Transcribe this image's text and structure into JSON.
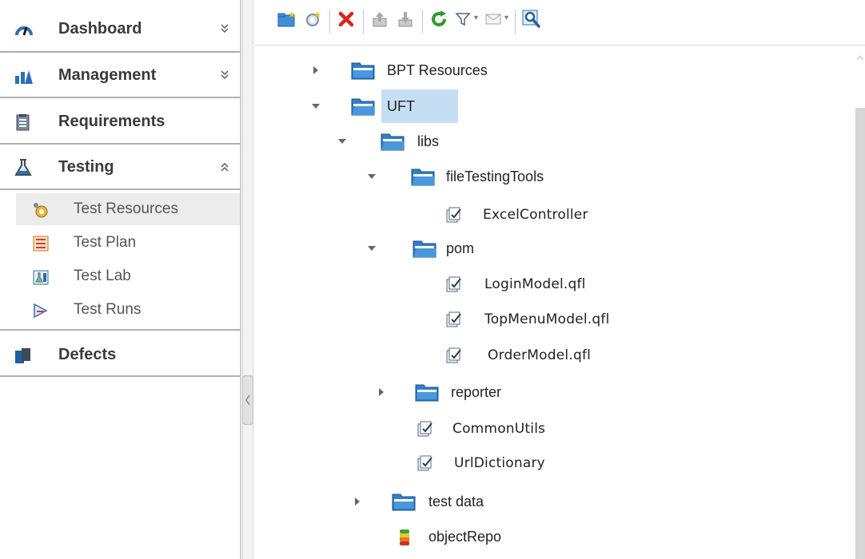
{
  "sidebar": {
    "modules": [
      {
        "label": "Dashboard",
        "icon": "dashboard-gauge-icon",
        "expanded": false
      },
      {
        "label": "Management",
        "icon": "management-chart-icon",
        "expanded": false
      },
      {
        "label": "Requirements",
        "icon": "requirements-clipboard-icon"
      },
      {
        "label": "Testing",
        "icon": "testing-flask-icon",
        "expanded": true
      },
      {
        "label": "Defects",
        "icon": "defects-document-icon"
      }
    ],
    "testing_items": [
      {
        "label": "Test Resources",
        "icon": "test-resources-gear-icon",
        "selected": true
      },
      {
        "label": "Test Plan",
        "icon": "test-plan-icon"
      },
      {
        "label": "Test Lab",
        "icon": "test-lab-icon"
      },
      {
        "label": "Test Runs",
        "icon": "test-runs-icon"
      }
    ]
  },
  "toolbar": {
    "buttons": [
      "new-folder-icon",
      "new-resource-icon",
      "delete-icon",
      "upload-icon",
      "download-icon",
      "refresh-icon",
      "filter-icon",
      "email-icon",
      "find-icon"
    ]
  },
  "tree": {
    "nodes": [
      {
        "label": "BPT Resources",
        "type": "folder",
        "state": "collapsed"
      },
      {
        "label": "UFT",
        "type": "folder",
        "state": "expanded",
        "selected": true
      },
      {
        "label": "libs",
        "type": "folder",
        "state": "expanded"
      },
      {
        "label": "fileTestingTools",
        "type": "folder",
        "state": "expanded"
      },
      {
        "label": "ExcelController",
        "type": "resource"
      },
      {
        "label": "pom",
        "type": "folder",
        "state": "expanded"
      },
      {
        "label": "LoginModel.qfl",
        "type": "resource"
      },
      {
        "label": "TopMenuModel.qfl",
        "type": "resource"
      },
      {
        "label": "OrderModel.qfl",
        "type": "resource"
      },
      {
        "label": "reporter",
        "type": "folder",
        "state": "collapsed"
      },
      {
        "label": "CommonUtils",
        "type": "resource"
      },
      {
        "label": "UrlDictionary",
        "type": "resource"
      },
      {
        "label": "test data",
        "type": "folder",
        "state": "collapsed"
      },
      {
        "label": "objectRepo",
        "type": "object-repository"
      }
    ]
  },
  "colors": {
    "selection": "#c6def4",
    "folder_blue": "#2f7fc9",
    "delete_red": "#d9251d",
    "refresh_green": "#2e9a2e"
  }
}
